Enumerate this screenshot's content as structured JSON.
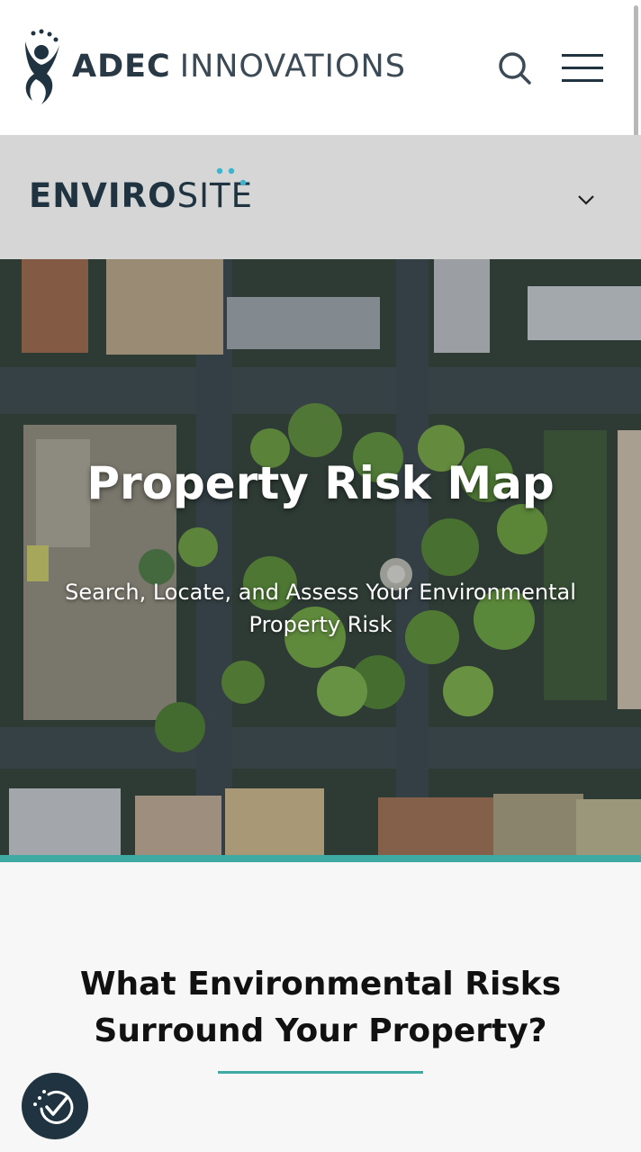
{
  "header": {
    "brand_bold": "ADEC",
    "brand_light": "INNOVATIONS",
    "brand_color": "#283845",
    "search_icon": "search-icon",
    "menu_icon": "hamburger-menu-icon"
  },
  "subnav": {
    "logo_bold": "ENVIRO",
    "logo_light": "SITE",
    "dots_color": "#3bb5cf",
    "toggle_icon": "chevron-down-icon"
  },
  "hero": {
    "title": "Property Risk Map",
    "subtitle": "Search, Locate, and Assess Your Environmental Property Risk"
  },
  "section": {
    "heading": "What Environmental Risks Surround Your Property?",
    "accent_color": "#3eaaa2"
  },
  "accessibility": {
    "icon": "accessibility-check-icon"
  }
}
